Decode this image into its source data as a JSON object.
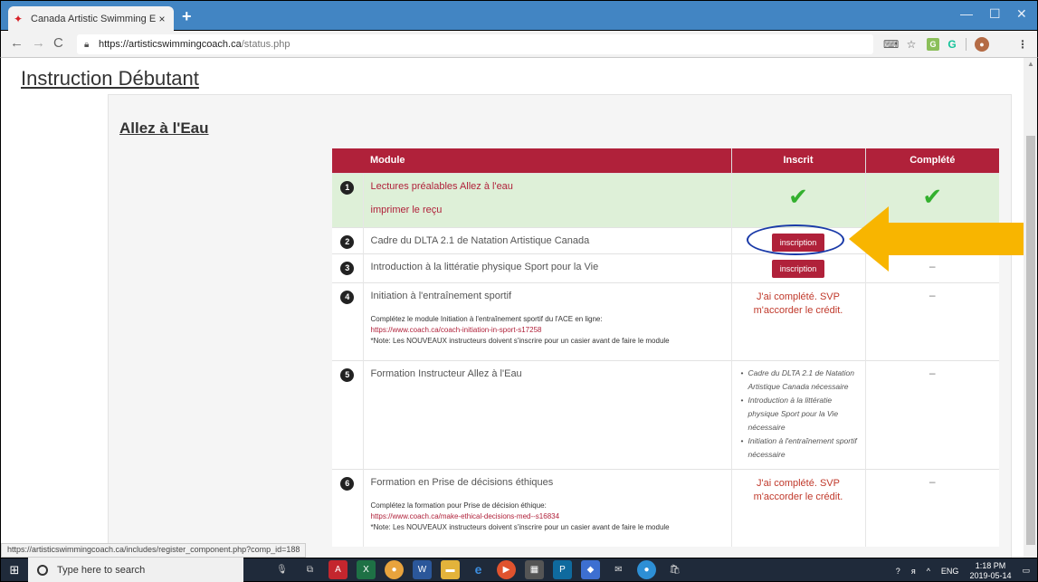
{
  "browser": {
    "tab_title": "Canada Artistic Swimming Entrai",
    "tab_close": "×",
    "new_tab": "+",
    "url_host": "https://artisticswimmingcoach.ca",
    "url_path": "/status.php",
    "status_bar_url": "https://artisticswimmingcoach.ca/includes/register_component.php?comp_id=188",
    "icons": [
      "back-arrow-icon",
      "forward-arrow-icon",
      "reload-icon",
      "lock-icon",
      "translate-icon",
      "star-icon",
      "extension-icon",
      "grammarly-icon",
      "profile-icon",
      "menu-icon"
    ]
  },
  "page": {
    "title": "Instruction Débutant",
    "section_title": "Allez à l'Eau"
  },
  "table": {
    "headers": {
      "module": "Module",
      "inscrit": "Inscrit",
      "complete": "Complété"
    },
    "rows": [
      {
        "num": "1",
        "title": "Lectures préalables Allez à l'eau",
        "extra_link": "imprimer le reçu",
        "status": "done"
      },
      {
        "num": "2",
        "title": "Cadre du DLTA 2.1 de Natation Artistique Canada",
        "button": "inscription",
        "complete": "–"
      },
      {
        "num": "3",
        "title": "Introduction à la littératie physique Sport pour la Vie",
        "button": "inscription",
        "complete": "–"
      },
      {
        "num": "4",
        "title": "Initiation à l'entraînement sportif",
        "instruction": "Complétez le module Initiation à l'entraînement sportif du l'ACE en ligne:",
        "link": "https://www.coach.ca/coach-initiation-in-sport-s17258",
        "note": "*Note: Les NOUVEAUX instructeurs doivent s'inscrire pour un casier avant de faire le module",
        "credit": "J'ai complété. SVP m'accorder le crédit.",
        "complete": "–"
      },
      {
        "num": "5",
        "title": "Formation Instructeur Allez à l'Eau",
        "prereqs": [
          "Cadre du DLTA 2.1 de Natation Artistique Canada nécessaire",
          "Introduction à la littératie physique Sport pour la Vie nécessaire",
          "Initiation à l'entraînement sportif nécessaire"
        ],
        "complete": "–"
      },
      {
        "num": "6",
        "title": "Formation en Prise de décisions éthiques",
        "instruction": "Complétez la formation pour Prise de décision éthique:",
        "link": "https://www.coach.ca/make-ethical-decisions-med--s16834",
        "note": "*Note: Les NOUVEAUX instructeurs doivent s'inscrire pour un casier avant de faire le module",
        "credit": "J'ai complété. SVP m'accorder le crédit.",
        "complete": "–"
      }
    ]
  },
  "taskbar": {
    "search_placeholder": "Type here to search",
    "language": "ENG",
    "time": "1:18 PM",
    "date": "2019-05-14"
  },
  "colors": {
    "header_red": "#b0213a",
    "done_green": "#def0d8",
    "check_green": "#33b02e",
    "highlight_blue": "#1a3aa8",
    "arrow_yellow": "#f8b500"
  }
}
